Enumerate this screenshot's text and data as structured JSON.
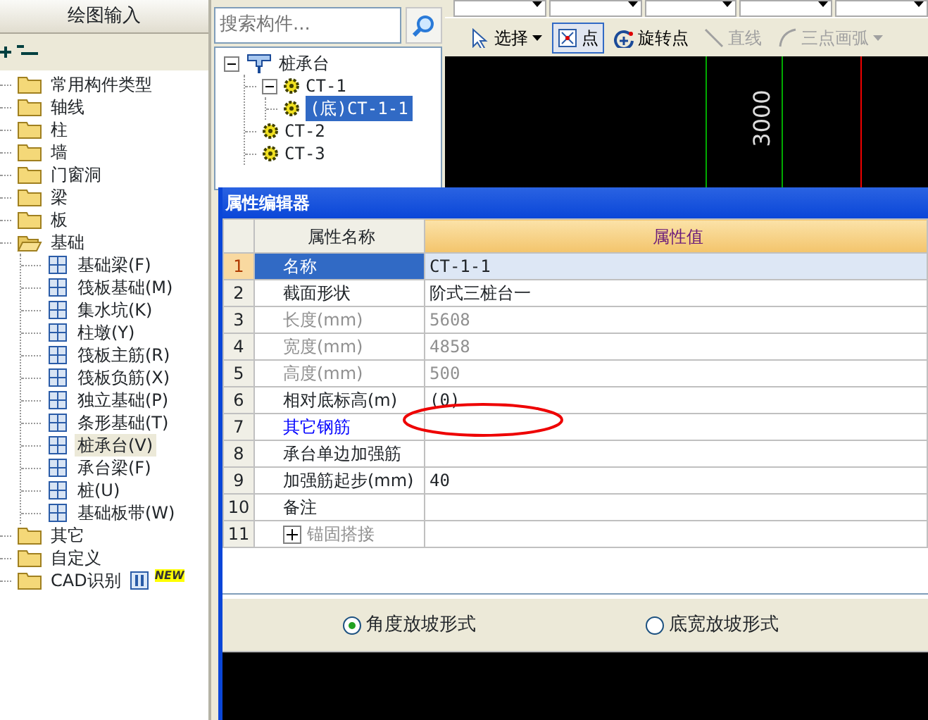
{
  "left_panel": {
    "title": "绘图输入",
    "tree": [
      {
        "label": "常用构件类型",
        "expanded": false
      },
      {
        "label": "轴线",
        "expanded": false
      },
      {
        "label": "柱",
        "expanded": false
      },
      {
        "label": "墙",
        "expanded": false
      },
      {
        "label": "门窗洞",
        "expanded": false
      },
      {
        "label": "梁",
        "expanded": false
      },
      {
        "label": "板",
        "expanded": false
      },
      {
        "label": "基础",
        "expanded": true,
        "children": [
          {
            "label": "基础梁(F)",
            "selected": false
          },
          {
            "label": "筏板基础(M)",
            "selected": false
          },
          {
            "label": "集水坑(K)",
            "selected": false
          },
          {
            "label": "柱墩(Y)",
            "selected": false
          },
          {
            "label": "筏板主筋(R)",
            "selected": false
          },
          {
            "label": "筏板负筋(X)",
            "selected": false
          },
          {
            "label": "独立基础(P)",
            "selected": false
          },
          {
            "label": "条形基础(T)",
            "selected": false
          },
          {
            "label": "桩承台(V)",
            "selected": true
          },
          {
            "label": "承台梁(F)",
            "selected": false
          },
          {
            "label": "桩(U)",
            "selected": false
          },
          {
            "label": "基础板带(W)",
            "selected": false
          }
        ]
      },
      {
        "label": "其它",
        "expanded": false
      },
      {
        "label": "自定义",
        "expanded": false
      },
      {
        "label": "CAD识别",
        "expanded": false,
        "badge": "NEW"
      }
    ]
  },
  "search": {
    "placeholder": "搜索构件..."
  },
  "component_tree": [
    {
      "label": "桩承台",
      "expanded": true,
      "children": [
        {
          "label": "CT-1",
          "expanded": true,
          "children": [
            {
              "label": "(底)CT-1-1",
              "selected": true
            }
          ]
        },
        {
          "label": "CT-2",
          "selected": false
        },
        {
          "label": "CT-3",
          "selected": false
        }
      ]
    }
  ],
  "toolbar": [
    {
      "label": "选择",
      "kind": "select",
      "pressed": false,
      "disabled": false,
      "dropdown": true
    },
    {
      "label": "点",
      "kind": "point",
      "pressed": true,
      "disabled": false,
      "dropdown": false
    },
    {
      "label": "旋转点",
      "kind": "rotate",
      "pressed": false,
      "disabled": false,
      "dropdown": false
    },
    {
      "label": "直线",
      "kind": "line",
      "pressed": false,
      "disabled": true,
      "dropdown": false
    },
    {
      "label": "三点画弧",
      "kind": "arc",
      "pressed": false,
      "disabled": true,
      "dropdown": true
    }
  ],
  "canvas": {
    "dimension_label": "3000"
  },
  "property_editor": {
    "title": "属性编辑器",
    "columns": [
      "属性名称",
      "属性值"
    ],
    "rows": [
      {
        "index": "1",
        "name": "名称",
        "value": "CT-1-1",
        "kind": "normal",
        "selected": true
      },
      {
        "index": "2",
        "name": "截面形状",
        "value": "阶式三桩台一",
        "kind": "normal",
        "selected": false
      },
      {
        "index": "3",
        "name": "长度(mm)",
        "value": "5608",
        "kind": "readonly",
        "selected": false
      },
      {
        "index": "4",
        "name": "宽度(mm)",
        "value": "4858",
        "kind": "readonly",
        "selected": false
      },
      {
        "index": "5",
        "name": "高度(mm)",
        "value": "500",
        "kind": "readonly",
        "selected": false
      },
      {
        "index": "6",
        "name": "相对底标高(m)",
        "value": "(0)",
        "kind": "normal",
        "selected": false
      },
      {
        "index": "7",
        "name": "其它钢筋",
        "kind": "link",
        "selected": false
      },
      {
        "index": "8",
        "name": "承台单边加强筋",
        "kind": "normal",
        "selected": false
      },
      {
        "index": "9",
        "name": "加强筋起步(mm)",
        "value": "40",
        "kind": "normal",
        "selected": false
      },
      {
        "index": "10",
        "name": "备注",
        "kind": "normal",
        "selected": false
      },
      {
        "index": "11",
        "name": "锚固搭接",
        "kind": "group",
        "selected": false,
        "expanded": false
      }
    ],
    "options": [
      {
        "label": "角度放坡形式",
        "selected": true
      },
      {
        "label": "底宽放坡形式",
        "selected": false
      }
    ]
  }
}
